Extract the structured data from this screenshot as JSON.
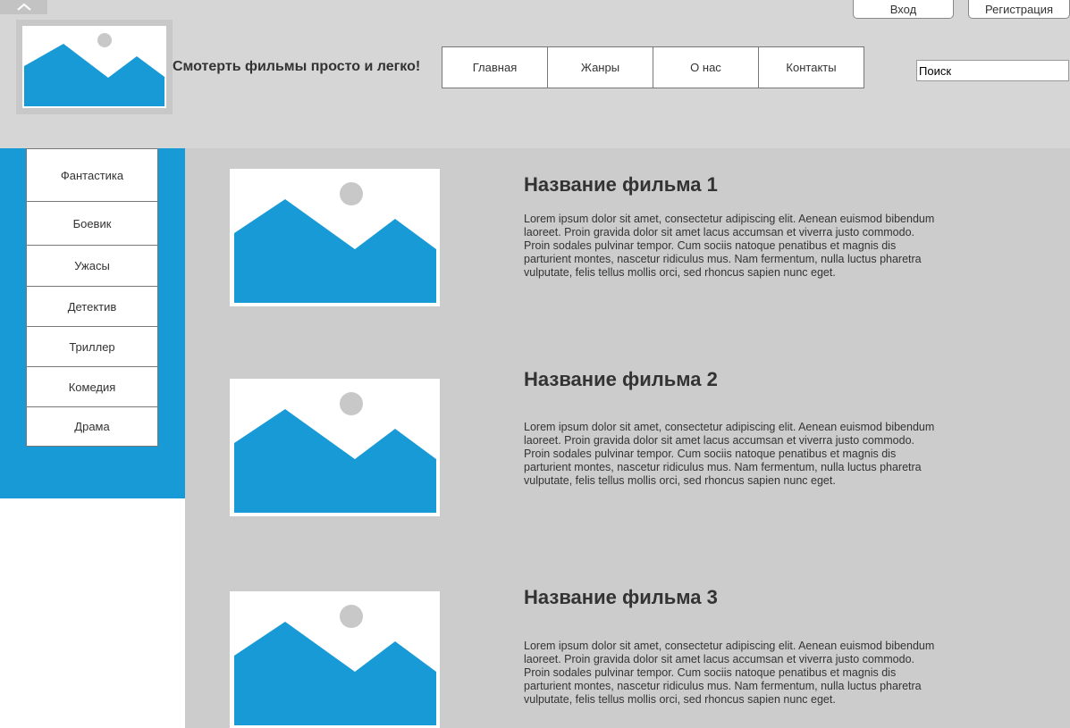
{
  "header": {
    "tagline": "Смотерть фильмы просто и легко!",
    "nav": [
      "Главная",
      "Жанры",
      "О нас",
      "Контакты"
    ],
    "login_label": "Вход",
    "register_label": "Регистрация",
    "search_placeholder": "Поиск"
  },
  "sidebar": {
    "genres": [
      "Фантастика",
      "Боевик",
      "Ужасы",
      "Детектив",
      "Триллер",
      "Комедия",
      "Драма"
    ]
  },
  "movies": [
    {
      "title": "Название фильма 1",
      "description": "Lorem ipsum dolor sit amet, consectetur adipiscing elit. Aenean euismod bibendum laoreet. Proin gravida dolor sit amet lacus accumsan et viverra justo commodo. Proin sodales pulvinar tempor. Cum sociis natoque penatibus et magnis dis parturient montes, nascetur ridiculus mus. Nam fermentum, nulla luctus pharetra vulputate, felis tellus mollis orci, sed rhoncus sapien nunc eget."
    },
    {
      "title": "Название фильма 2",
      "description": "Lorem ipsum dolor sit amet, consectetur adipiscing elit. Aenean euismod bibendum laoreet. Proin gravida dolor sit amet lacus accumsan et viverra justo commodo. Proin sodales pulvinar tempor. Cum sociis natoque penatibus et magnis dis parturient montes, nascetur ridiculus mus. Nam fermentum, nulla luctus pharetra vulputate, felis tellus mollis orci, sed rhoncus sapien nunc eget."
    },
    {
      "title": "Название фильма 3",
      "description": "Lorem ipsum dolor sit amet, consectetur adipiscing elit. Aenean euismod bibendum laoreet. Proin gravida dolor sit amet lacus accumsan et viverra justo commodo. Proin sodales pulvinar tempor. Cum sociis natoque penatibus et magnis dis parturient montes, nascetur ridiculus mus. Nam fermentum, nulla luctus pharetra vulputate, felis tellus mollis orci, sed rhoncus sapien nunc eget."
    }
  ],
  "icons": {
    "collapse": "chevron-up-icon",
    "logo": "image-placeholder-icon",
    "poster": "image-placeholder-icon"
  },
  "colors": {
    "accent_blue": "#189ad6",
    "header_bg": "#d6d6d6",
    "content_bg": "#cccccc",
    "placeholder_sun": "#c8c8c8"
  }
}
